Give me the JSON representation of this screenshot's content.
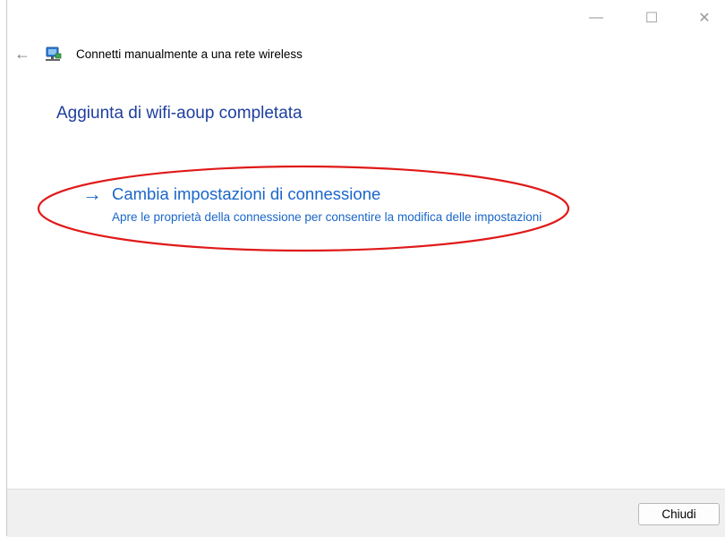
{
  "window": {
    "title": "Connetti manualmente a una rete wireless",
    "minimize_glyph": "—",
    "maximize_glyph": "☐",
    "close_glyph": "✕",
    "back_glyph": "←"
  },
  "content": {
    "heading": "Aggiunta di wifi-aoup completata",
    "link_arrow_glyph": "→",
    "link_title": "Cambia impostazioni di connessione",
    "link_description": "Apre le proprietà della connessione per consentire la modifica delle impostazioni"
  },
  "footer": {
    "close_button_label": "Chiudi"
  },
  "colors": {
    "heading": "#1f3f9e",
    "link": "#1a66c8",
    "annotation": "#e01919"
  },
  "icons": {
    "back": "arrow-left-icon",
    "network": "network-wifi-icon"
  }
}
